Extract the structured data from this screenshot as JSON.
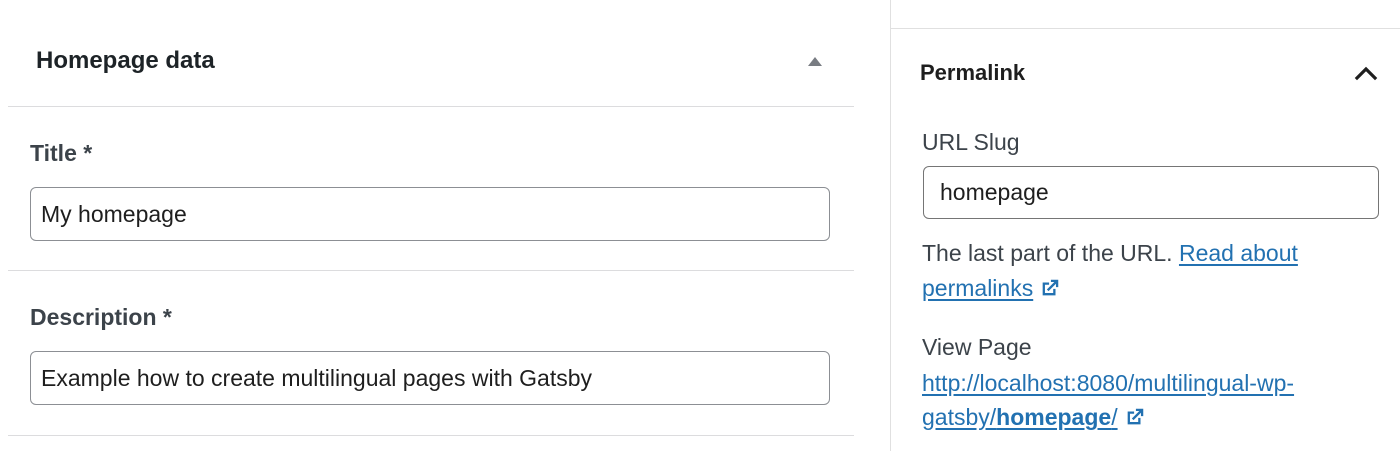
{
  "metabox": {
    "title": "Homepage data",
    "toggle_icon": "triangle-up-icon"
  },
  "fields": {
    "title": {
      "label": "Title *",
      "value": "My homepage"
    },
    "description": {
      "label": "Description *",
      "value": "Example how to create multilingual pages with Gatsby"
    }
  },
  "sidebar": {
    "panel_title": "Permalink",
    "panel_toggle_icon": "chevron-up-icon",
    "slug_label": "URL Slug",
    "slug_value": "homepage",
    "help_text": "The last part of the URL.",
    "help_link_text_1": "Read about",
    "help_link_text_2": "permalinks",
    "view_label": "View Page",
    "view_url_part1": "http://localhost:8080/multilingual-wp-",
    "view_url_part2": "gatsby/",
    "view_url_slug": "homepage",
    "view_url_end": "/",
    "external_icon": "external-link-icon"
  },
  "colors": {
    "link": "#2271b1",
    "border": "#dcdcde",
    "text": "#1e1e1e"
  }
}
